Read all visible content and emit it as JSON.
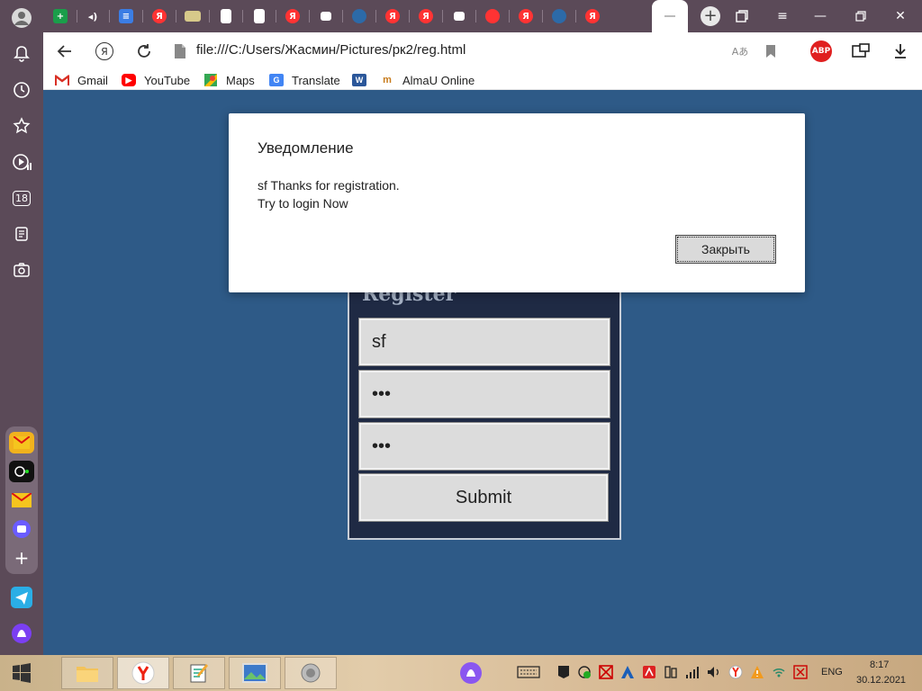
{
  "colors": {
    "sidebar": "#5b4a58",
    "page_background": "#2e5a87",
    "form_background": "#1f2a44",
    "abp_badge": "#e02020"
  },
  "browser": {
    "address": {
      "url": "file:///C:/Users/Жасмин/Pictures/рк2/reg.html",
      "yandex_button": "Я"
    },
    "abp_badge": "ABP",
    "bookmarks": [
      {
        "label": "Gmail",
        "icon": "gmail-icon"
      },
      {
        "label": "YouTube",
        "icon": "youtube-icon"
      },
      {
        "label": "Maps",
        "icon": "maps-icon"
      },
      {
        "label": "Translate",
        "icon": "translate-icon"
      },
      {
        "label": "",
        "icon": "word-icon"
      },
      {
        "label": "AlmaU Online",
        "icon": "almau-icon"
      }
    ],
    "tab_yandex_letter": "Я",
    "sidebar_badge": "18"
  },
  "page": {
    "form": {
      "title": "Register",
      "username_value": "sf",
      "password_value": "•••",
      "confirm_value": "•••",
      "submit_label": "Submit"
    }
  },
  "dialog": {
    "title": "Уведомление",
    "line1": "sf  Thanks for registration.",
    "line2": "Try to login Now",
    "close_label": "Закрыть"
  },
  "taskbar": {
    "language": "ENG",
    "time": "8:17",
    "date": "30.12.2021"
  }
}
